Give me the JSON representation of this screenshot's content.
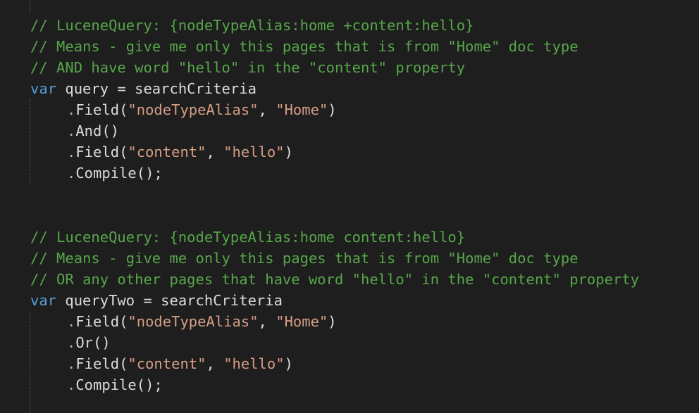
{
  "blocks": [
    {
      "comments": [
        "// LuceneQuery: {nodeTypeAlias:home +content:hello}",
        "// Means - give me only this pages that is from \"Home\" doc type",
        "// AND have word \"hello\" in the \"content\" property"
      ],
      "declaration": {
        "keyword": "var",
        "variable": "query",
        "assign": "=",
        "source": "searchCriteria"
      },
      "chain": [
        {
          "method": "Field",
          "args": [
            "\"nodeTypeAlias\"",
            "\"Home\""
          ]
        },
        {
          "method": "And",
          "args": []
        },
        {
          "method": "Field",
          "args": [
            "\"content\"",
            "\"hello\""
          ]
        },
        {
          "method": "Compile",
          "args": [],
          "terminator": ";"
        }
      ]
    },
    {
      "comments": [
        "// LuceneQuery: {nodeTypeAlias:home content:hello}",
        "// Means - give me only this pages that is from \"Home\" doc type",
        "// OR any other pages that have word \"hello\" in the \"content\" property"
      ],
      "declaration": {
        "keyword": "var",
        "variable": "queryTwo",
        "assign": "=",
        "source": "searchCriteria"
      },
      "chain": [
        {
          "method": "Field",
          "args": [
            "\"nodeTypeAlias\"",
            "\"Home\""
          ]
        },
        {
          "method": "Or",
          "args": []
        },
        {
          "method": "Field",
          "args": [
            "\"content\"",
            "\"hello\""
          ]
        },
        {
          "method": "Compile",
          "args": [],
          "terminator": ";"
        }
      ]
    }
  ],
  "colors": {
    "background": "#1e1e1e",
    "comment": "#57a64a",
    "keyword": "#569cd6",
    "string": "#d69d85",
    "identifier": "#dcdcdc",
    "indent_guide": "#5a5a5a"
  }
}
